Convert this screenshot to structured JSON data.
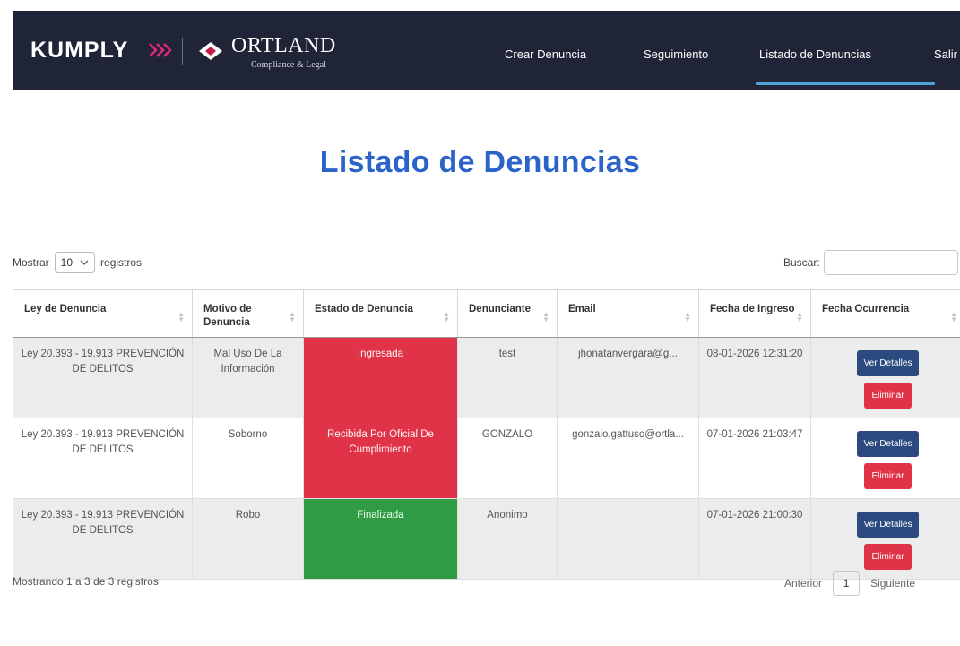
{
  "navbar": {
    "brand_kumply": "KUMPLY",
    "brand_ortland": "ORTLAND",
    "brand_ortland_sub": "Compliance & Legal",
    "links": [
      {
        "label": "Crear Denuncia"
      },
      {
        "label": "Seguimiento"
      },
      {
        "label": "Listado de Denuncias",
        "active": true
      },
      {
        "label": "Salir"
      }
    ],
    "background_color": "#1f2436",
    "active_underline_color": "#4fa3d9"
  },
  "page": {
    "title": "Listado de Denuncias",
    "title_color": "#2c63c9"
  },
  "controls": {
    "show_label": "Mostrar",
    "page_length": "10",
    "records_label": "registros",
    "search_label": "Buscar:",
    "search_value": ""
  },
  "table": {
    "headers": [
      "Ley de Denuncia",
      "Motivo de Denuncia",
      "Estado de Denuncia",
      "Denunciante",
      "Email",
      "Fecha de Ingreso",
      "Fecha Ocurrencia"
    ],
    "rows": [
      {
        "ley": "Ley 20.393 - 19.913 PREVENCIÓN DE DELITOS",
        "motivo": "Mal Uso De La Información",
        "estado": "Ingresada",
        "estado_color": "#e03347",
        "denunciante": "test",
        "email": "jhonatanvergara@g...",
        "fecha_ingreso": "08-01-2026 12:31:20",
        "fecha_ocurrencia": "",
        "ver_label": "Ver Detalles",
        "eliminar_label": "Eliminar"
      },
      {
        "ley": "Ley 20.393 - 19.913 PREVENCIÓN DE DELITOS",
        "motivo": "Soborno",
        "estado": "Recibida Por Oficial De Cumplimiento",
        "estado_color": "#e03347",
        "denunciante": "GONZALO",
        "email": "gonzalo.gattuso@ortla...",
        "fecha_ingreso": "07-01-2026 21:03:47",
        "fecha_ocurrencia": "",
        "ver_label": "Ver Detalles",
        "eliminar_label": "Eliminar"
      },
      {
        "ley": "Ley 20.393 - 19.913 PREVENCIÓN DE DELITOS",
        "motivo": "Robo",
        "estado": "Finalizada",
        "estado_color": "#2f9b44",
        "denunciante": "Anonimo",
        "email": "",
        "fecha_ingreso": "07-01-2026 21:00:30",
        "fecha_ocurrencia": "",
        "ver_label": "Ver Detalles",
        "eliminar_label": "Eliminar"
      }
    ]
  },
  "footer": {
    "info": "Mostrando 1 a 3 de 3 registros",
    "prev_label": "Anterior",
    "current_page": "1",
    "next_label": "Siguiente"
  }
}
